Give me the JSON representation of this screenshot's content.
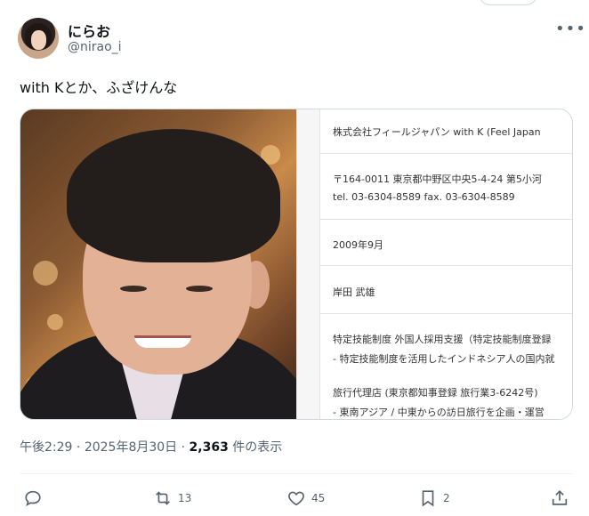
{
  "author": {
    "display_name": "にらお",
    "handle": "@nirao_i"
  },
  "tweet": {
    "text": "with Kとか、ふざけんな"
  },
  "document": {
    "company": "株式会社フィールジャパン with K (Feel Japan",
    "address": "〒164-0011 東京都中野区中央5-4-24 第5小河",
    "phone": "tel. 03-6304-8589 fax. 03-6304-8589",
    "established": "2009年9月",
    "representative": "岸田 武雄",
    "business_1": "特定技能制度 外国人採用支援（特定技能制度登録",
    "business_2": "- 特定技能制度を活用したインドネシア人の国内就",
    "business_3": "旅行代理店 (東京都知事登録 旅行業3-6242号)",
    "business_4": "- 東南アジア / 中東からの訪日旅行を企画・運営"
  },
  "meta": {
    "time": "午後2:29",
    "date": "2025年8月30日",
    "views_count": "2,363",
    "views_label": "件の表示",
    "separator": "·"
  },
  "actions": {
    "replies": "",
    "retweets": "13",
    "likes": "45",
    "bookmarks": "2"
  },
  "icons": {
    "more": "more-icon",
    "reply": "reply-icon",
    "retweet": "retweet-icon",
    "like": "heart-icon",
    "bookmark": "bookmark-icon",
    "share": "share-icon"
  },
  "colors": {
    "text_primary": "#0f1419",
    "text_secondary": "#536471",
    "border": "#cfd9de"
  }
}
